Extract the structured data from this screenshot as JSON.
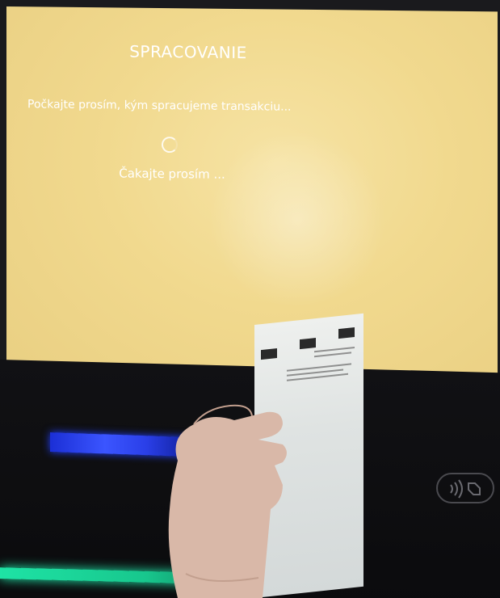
{
  "screen": {
    "title": "SPRACOVANIE",
    "message": "Počkajte prosím, kým spracujeme transakciu...",
    "wait_text": "Čakajte prosím ..."
  },
  "colors": {
    "screen_background": "#f1d98e",
    "screen_text": "#ffffff",
    "card_slot_light": "#2a3fe8",
    "bottom_light": "#1ee3a5"
  },
  "icons": {
    "spinner": "loading-spinner-icon",
    "contactless": "contactless-payment-icon"
  }
}
